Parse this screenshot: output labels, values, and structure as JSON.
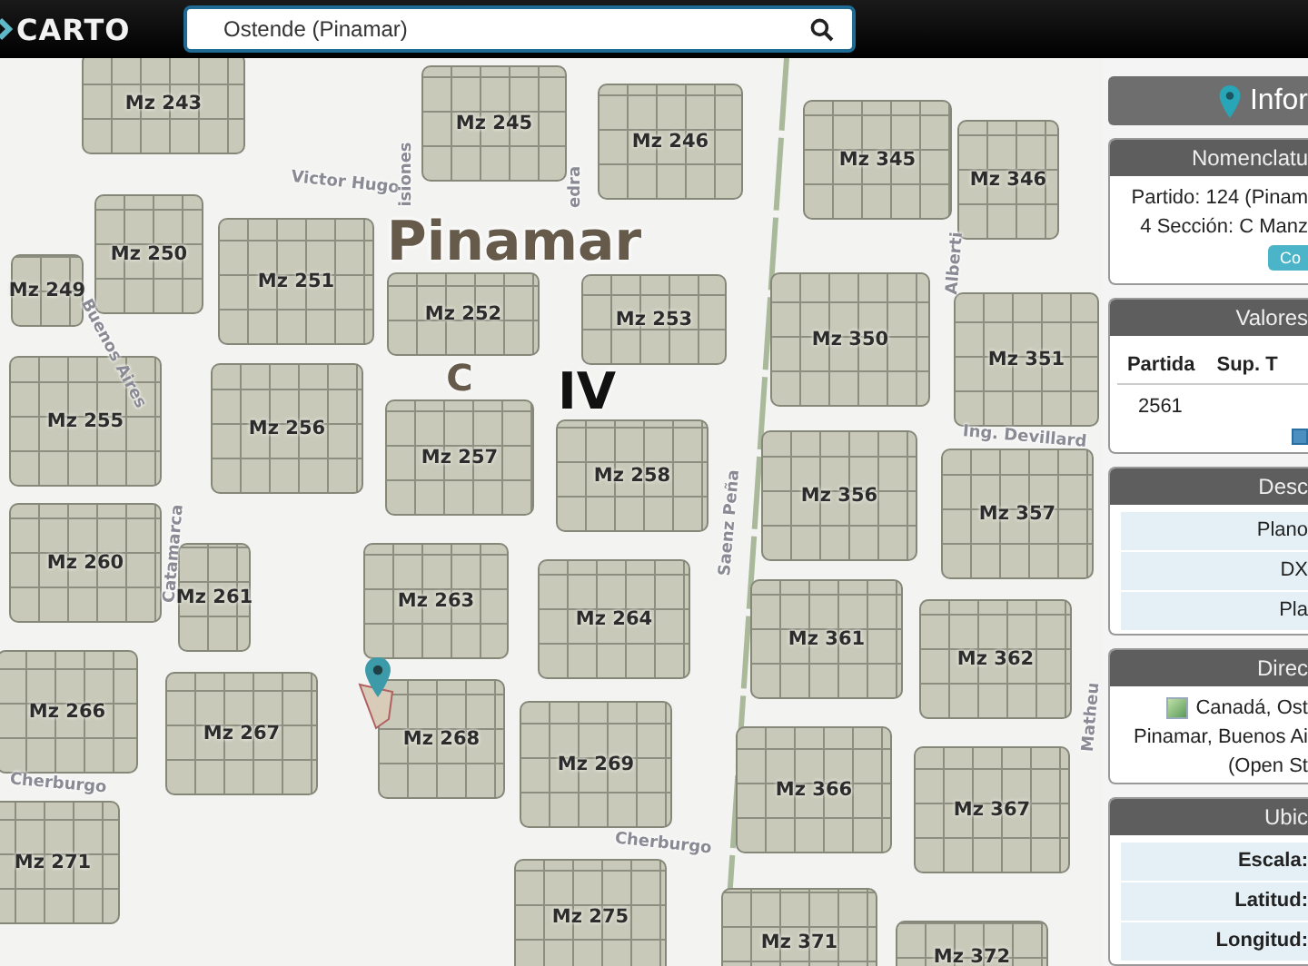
{
  "top_bar": {
    "logo": "CARTO",
    "search": {
      "value": "Ostende (Pinamar)"
    }
  },
  "map": {
    "place_label": "Pinamar",
    "section_labels": [
      {
        "text": "C",
        "kind": "minor"
      },
      {
        "text": "IV",
        "kind": "major"
      }
    ],
    "blocks": [
      {
        "label": "Mz 243"
      },
      {
        "label": "Mz 245"
      },
      {
        "label": "Mz 246"
      },
      {
        "label": "Mz 345"
      },
      {
        "label": "Mz 346"
      },
      {
        "label": "Mz 250"
      },
      {
        "label": "Mz 249"
      },
      {
        "label": "Mz 251"
      },
      {
        "label": "Mz 252"
      },
      {
        "label": "Mz 253"
      },
      {
        "label": "Mz 350"
      },
      {
        "label": "Mz 351"
      },
      {
        "label": "Mz 255"
      },
      {
        "label": "Mz 256"
      },
      {
        "label": "Mz 257"
      },
      {
        "label": "Mz 258"
      },
      {
        "label": "Mz 356"
      },
      {
        "label": "Mz 357"
      },
      {
        "label": "Mz 260"
      },
      {
        "label": "Mz 261"
      },
      {
        "label": "Mz 263"
      },
      {
        "label": "Mz 264"
      },
      {
        "label": "Mz 361"
      },
      {
        "label": "Mz 362"
      },
      {
        "label": "Mz 266"
      },
      {
        "label": "Mz 267"
      },
      {
        "label": "Mz 268"
      },
      {
        "label": "Mz 269"
      },
      {
        "label": "Mz 366"
      },
      {
        "label": "Mz 367"
      },
      {
        "label": "Mz 271"
      },
      {
        "label": "Mz 275"
      },
      {
        "label": "Mz 371"
      },
      {
        "label": "Mz 372"
      }
    ],
    "streets": [
      {
        "name": "Victor Hugo"
      },
      {
        "name": "isiones"
      },
      {
        "name": "edra"
      },
      {
        "name": "Buenos Aires"
      },
      {
        "name": "Alberti"
      },
      {
        "name": "Ing. Devillard"
      },
      {
        "name": "Saenz Peña"
      },
      {
        "name": "Catamarca"
      },
      {
        "name": "Matheu"
      },
      {
        "name": "Cherburgo"
      },
      {
        "name": "Cherburgo"
      }
    ]
  },
  "info_panel": {
    "title": "Infor",
    "sections": [
      {
        "kind": "text",
        "title": "Nomenclatu",
        "lines": [
          "Partido: 124 (Pinam",
          "4 Sección: C Manz"
        ],
        "button": "Co"
      },
      {
        "kind": "table",
        "title": "Valores",
        "columns": [
          "Partida",
          "Sup. T"
        ],
        "rows": [
          [
            "2561"
          ]
        ]
      },
      {
        "kind": "list",
        "title": "Desc",
        "items": [
          "Plano",
          "DX",
          "Pla"
        ]
      },
      {
        "kind": "address",
        "title": "Direc",
        "lines": [
          "Canadá, Ost",
          "Pinamar, Buenos Ai",
          "(Open St"
        ]
      },
      {
        "kind": "fields",
        "title": "Ubic",
        "items": [
          "Escala:",
          "Latitud:",
          "Longitud:"
        ]
      }
    ]
  }
}
